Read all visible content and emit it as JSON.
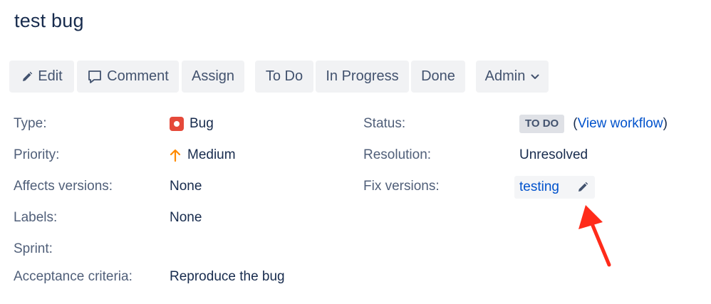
{
  "issue": {
    "title": "test bug"
  },
  "toolbar": {
    "edit_label": "Edit",
    "comment_label": "Comment",
    "assign_label": "Assign",
    "todo_label": "To Do",
    "in_progress_label": "In Progress",
    "done_label": "Done",
    "admin_label": "Admin"
  },
  "details": {
    "left": [
      {
        "label": "Type:",
        "value": "Bug",
        "icon": "bug-icon"
      },
      {
        "label": "Priority:",
        "value": "Medium",
        "icon": "arrow-up-icon"
      },
      {
        "label": "Affects versions:",
        "value": "None"
      },
      {
        "label": "Labels:",
        "value": "None"
      },
      {
        "label": "Sprint:",
        "value": ""
      },
      {
        "label": "Acceptance criteria:",
        "value": "Reproduce the bug"
      }
    ],
    "right": {
      "status_label": "Status:",
      "status_value": "TO DO",
      "view_workflow_open": "(",
      "view_workflow": "View workflow",
      "view_workflow_close": ")",
      "resolution_label": "Resolution:",
      "resolution_value": "Unresolved",
      "fix_versions_label": "Fix versions:",
      "fix_versions_value": "testing"
    }
  },
  "colors": {
    "bug": "#e5493a",
    "priority_medium": "#ff8b00",
    "link": "#0052cc",
    "annotation_arrow": "#ff2b1a"
  }
}
